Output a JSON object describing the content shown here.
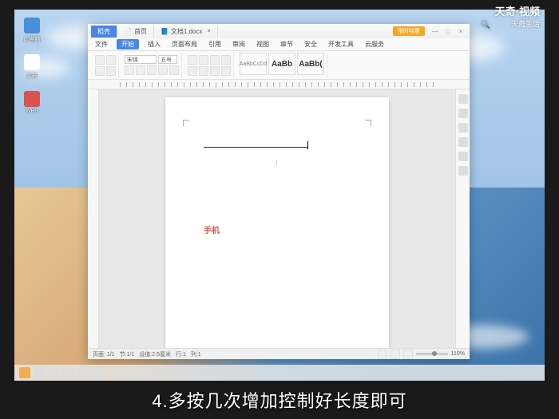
{
  "watermark": {
    "brand": "天奇·视频",
    "sub": "天奇生活"
  },
  "subtitle": "4.多按几次增加控制好长度即可",
  "desktop": {
    "icons": [
      "此电脑",
      "文档",
      "WPS"
    ]
  },
  "word": {
    "tabs": {
      "t1": "稻壳",
      "t2": "首页",
      "t3": "文档1.docx"
    },
    "vip": "限时特惠",
    "menu": {
      "file": "文件",
      "home": "开始",
      "insert": "插入",
      "layout": "页面布局",
      "ref": "引用",
      "review": "审阅",
      "view": "视图",
      "sec": "章节",
      "dev": "安全",
      "tools": "开发工具",
      "addon": "云服务"
    },
    "font": {
      "name": "宋体",
      "size": "五号"
    },
    "styles": {
      "s1": "AaBbCcDd",
      "s2": "AaBb",
      "s3": "AaBb("
    },
    "doc": {
      "red_text": "手机"
    },
    "status": {
      "page": "页面: 1/1",
      "words": "节:1/1",
      "pos": "设值:2.5厘米",
      "line": "行:1",
      "col": "列:1",
      "zoom": "110%"
    }
  }
}
